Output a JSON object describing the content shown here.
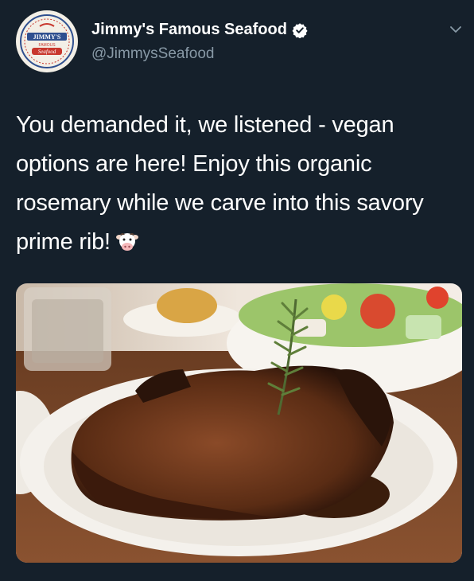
{
  "tweet": {
    "display_name": "Jimmy's Famous Seafood",
    "handle": "@JimmysSeafood",
    "verified": true,
    "text": "You demanded it, we listened - vegan options are here! Enjoy this organic rosemary while we carve into this savory prime rib!",
    "emoji": "cow-face-emoji",
    "avatar_logo_text": [
      "JIMMY'S",
      "FAMOUS",
      "Seafood"
    ]
  },
  "icons": {
    "verified": "verified-badge-icon",
    "menu": "chevron-down-icon"
  },
  "colors": {
    "background": "#15202b",
    "primary_text": "#ffffff",
    "secondary_text": "#8899a6",
    "logo_red": "#c8372d",
    "logo_blue": "#2f4f8f"
  }
}
